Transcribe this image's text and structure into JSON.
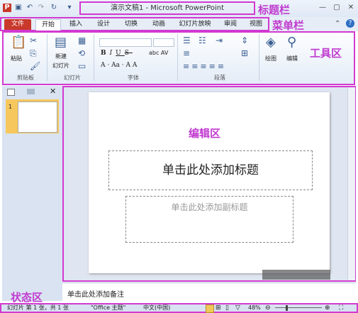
{
  "window": {
    "title": "演示文稿1 - Microsoft PowerPoint",
    "annotation_titlebar": "标题栏",
    "annotation_menubar": "菜单栏",
    "annotation_ribbon": "工具区",
    "annotation_edit": "编辑区",
    "annotation_status": "状态区"
  },
  "menu": {
    "tabs": [
      "文件",
      "开始",
      "插入",
      "设计",
      "切换",
      "动画",
      "幻灯片放映",
      "审阅",
      "视图"
    ]
  },
  "ribbon": {
    "paste": "粘贴",
    "new_slide": "新建",
    "slide": "幻灯片",
    "find": "绘图",
    "edit": "编辑",
    "groups": [
      "剪贴板",
      "幻灯片",
      "字体",
      "段落"
    ]
  },
  "slide": {
    "number": "1",
    "title_placeholder": "单击此处添加标题",
    "subtitle_placeholder": "单击此处添加副标题"
  },
  "notes": {
    "placeholder": "单击此处添加备注"
  },
  "status": {
    "slide_info": "幻灯片 第 1 张，共 1 张",
    "theme": "\"Office 主题\"",
    "language": "中文(中国)",
    "zoom": "48%"
  },
  "colors": {
    "annotation": "#c13bd0",
    "file_tab": "#c8382b"
  }
}
